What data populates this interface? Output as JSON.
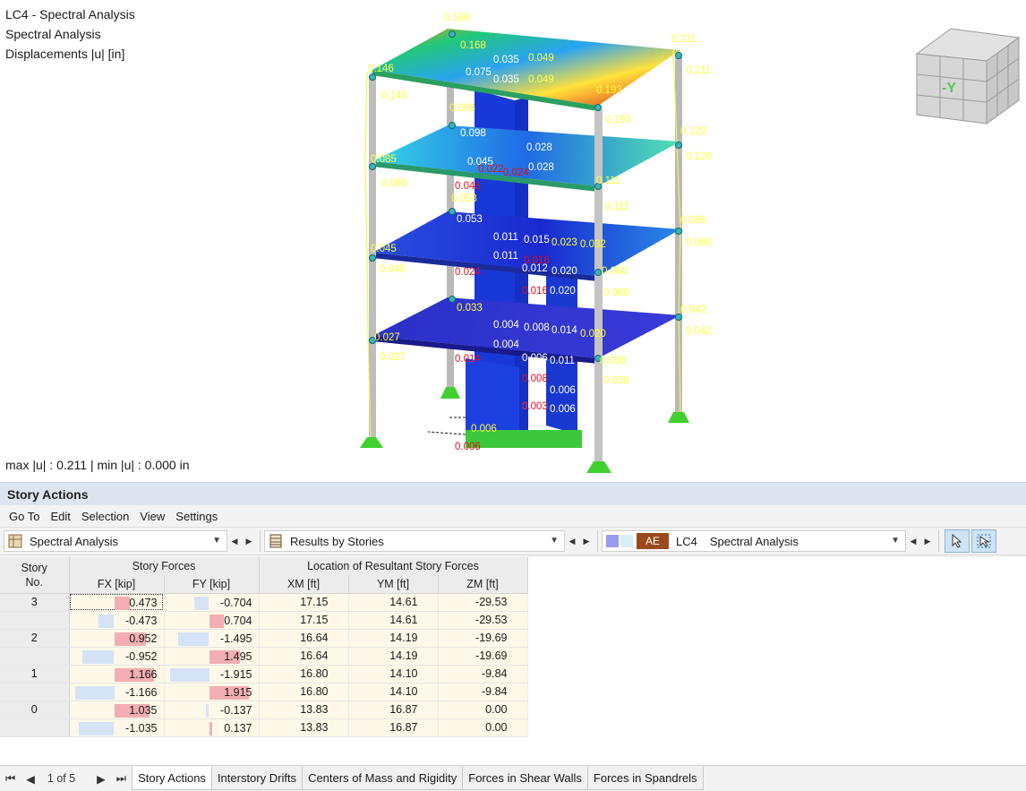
{
  "viewport": {
    "info_lines": [
      "LC4 - Spectral Analysis",
      "Spectral Analysis",
      "Displacements |u| [in]"
    ],
    "footer": "max |u| : 0.211 | min |u| : 0.000 in",
    "view_cube_label": "-Y",
    "labels": {
      "yellow": [
        "0.168",
        "0.168",
        "0.049",
        "0.049",
        "0.211",
        "0.211",
        "0.146",
        "0.146",
        "0.193",
        "0.193",
        "0.098",
        "0.120",
        "0.120",
        "0.085",
        "0.085",
        "0.111",
        "0.111",
        "0.053",
        "0.086",
        "0.066",
        "0.045",
        "0.045",
        "0.060",
        "0.060",
        "0.033",
        "0.032",
        "0.023",
        "0.042",
        "0.042",
        "0.027",
        "0.027",
        "0.020",
        "0.038",
        "0.038",
        "0.006"
      ],
      "white": [
        "0.075",
        "0.035",
        "0.035",
        "0.098",
        "0.028",
        "0.028",
        "0.045",
        "0.053",
        "0.011",
        "0.011",
        "0.015",
        "0.012",
        "0.020",
        "0.020",
        "0.004",
        "0.004",
        "0.008",
        "0.014",
        "0.006",
        "0.011",
        "0.006",
        "0.006",
        "0.003"
      ],
      "red": [
        "0.022",
        "0.024",
        "0.045",
        "0.016",
        "0.024",
        "0.014",
        "0.016",
        "0.008",
        "0.003",
        "0.006"
      ]
    }
  },
  "panel": {
    "title": "Story Actions",
    "menu": [
      "Go To",
      "Edit",
      "Selection",
      "View",
      "Settings"
    ],
    "toolbar": {
      "analysis_combo": "Spectral Analysis",
      "results_combo": "Results by Stories",
      "lc_badge": "AE",
      "lc_code": "LC4",
      "lc_name": "Spectral Analysis"
    },
    "table": {
      "group_headers": {
        "story": "Story\nNo.",
        "forces": "Story Forces",
        "location": "Location of Resultant Story Forces"
      },
      "columns": [
        "FX [kip]",
        "FY [kip]",
        "XM [ft]",
        "YM [ft]",
        "ZM [ft]"
      ],
      "rows": [
        {
          "story": "3",
          "fx": 0.473,
          "fy": -0.704,
          "xm": "17.15",
          "ym": "14.61",
          "zm": "-29.53"
        },
        {
          "story": "",
          "fx": -0.473,
          "fy": 0.704,
          "xm": "17.15",
          "ym": "14.61",
          "zm": "-29.53"
        },
        {
          "story": "2",
          "fx": 0.952,
          "fy": -1.495,
          "xm": "16.64",
          "ym": "14.19",
          "zm": "-19.69"
        },
        {
          "story": "",
          "fx": -0.952,
          "fy": 1.495,
          "xm": "16.64",
          "ym": "14.19",
          "zm": "-19.69"
        },
        {
          "story": "1",
          "fx": 1.166,
          "fy": -1.915,
          "xm": "16.80",
          "ym": "14.10",
          "zm": "-9.84"
        },
        {
          "story": "",
          "fx": -1.166,
          "fy": 1.915,
          "xm": "16.80",
          "ym": "14.10",
          "zm": "-9.84"
        },
        {
          "story": "0",
          "fx": 1.035,
          "fy": -0.137,
          "xm": "13.83",
          "ym": "16.87",
          "zm": "0.00"
        },
        {
          "story": "",
          "fx": -1.035,
          "fy": 0.137,
          "xm": "13.83",
          "ym": "16.87",
          "zm": "0.00"
        }
      ]
    },
    "pager": {
      "text": "1 of 5"
    },
    "tabs": [
      "Story Actions",
      "Interstory Drifts",
      "Centers of Mass and Rigidity",
      "Forces in Shear Walls",
      "Forces in Spandrels"
    ],
    "active_tab": 0
  },
  "colors": {
    "panel_title_bg": "#dde6f0",
    "pos_bar": "#f2aeb2",
    "neg_bar": "#d5e3f7",
    "ae_badge": "#9a4a1a"
  }
}
